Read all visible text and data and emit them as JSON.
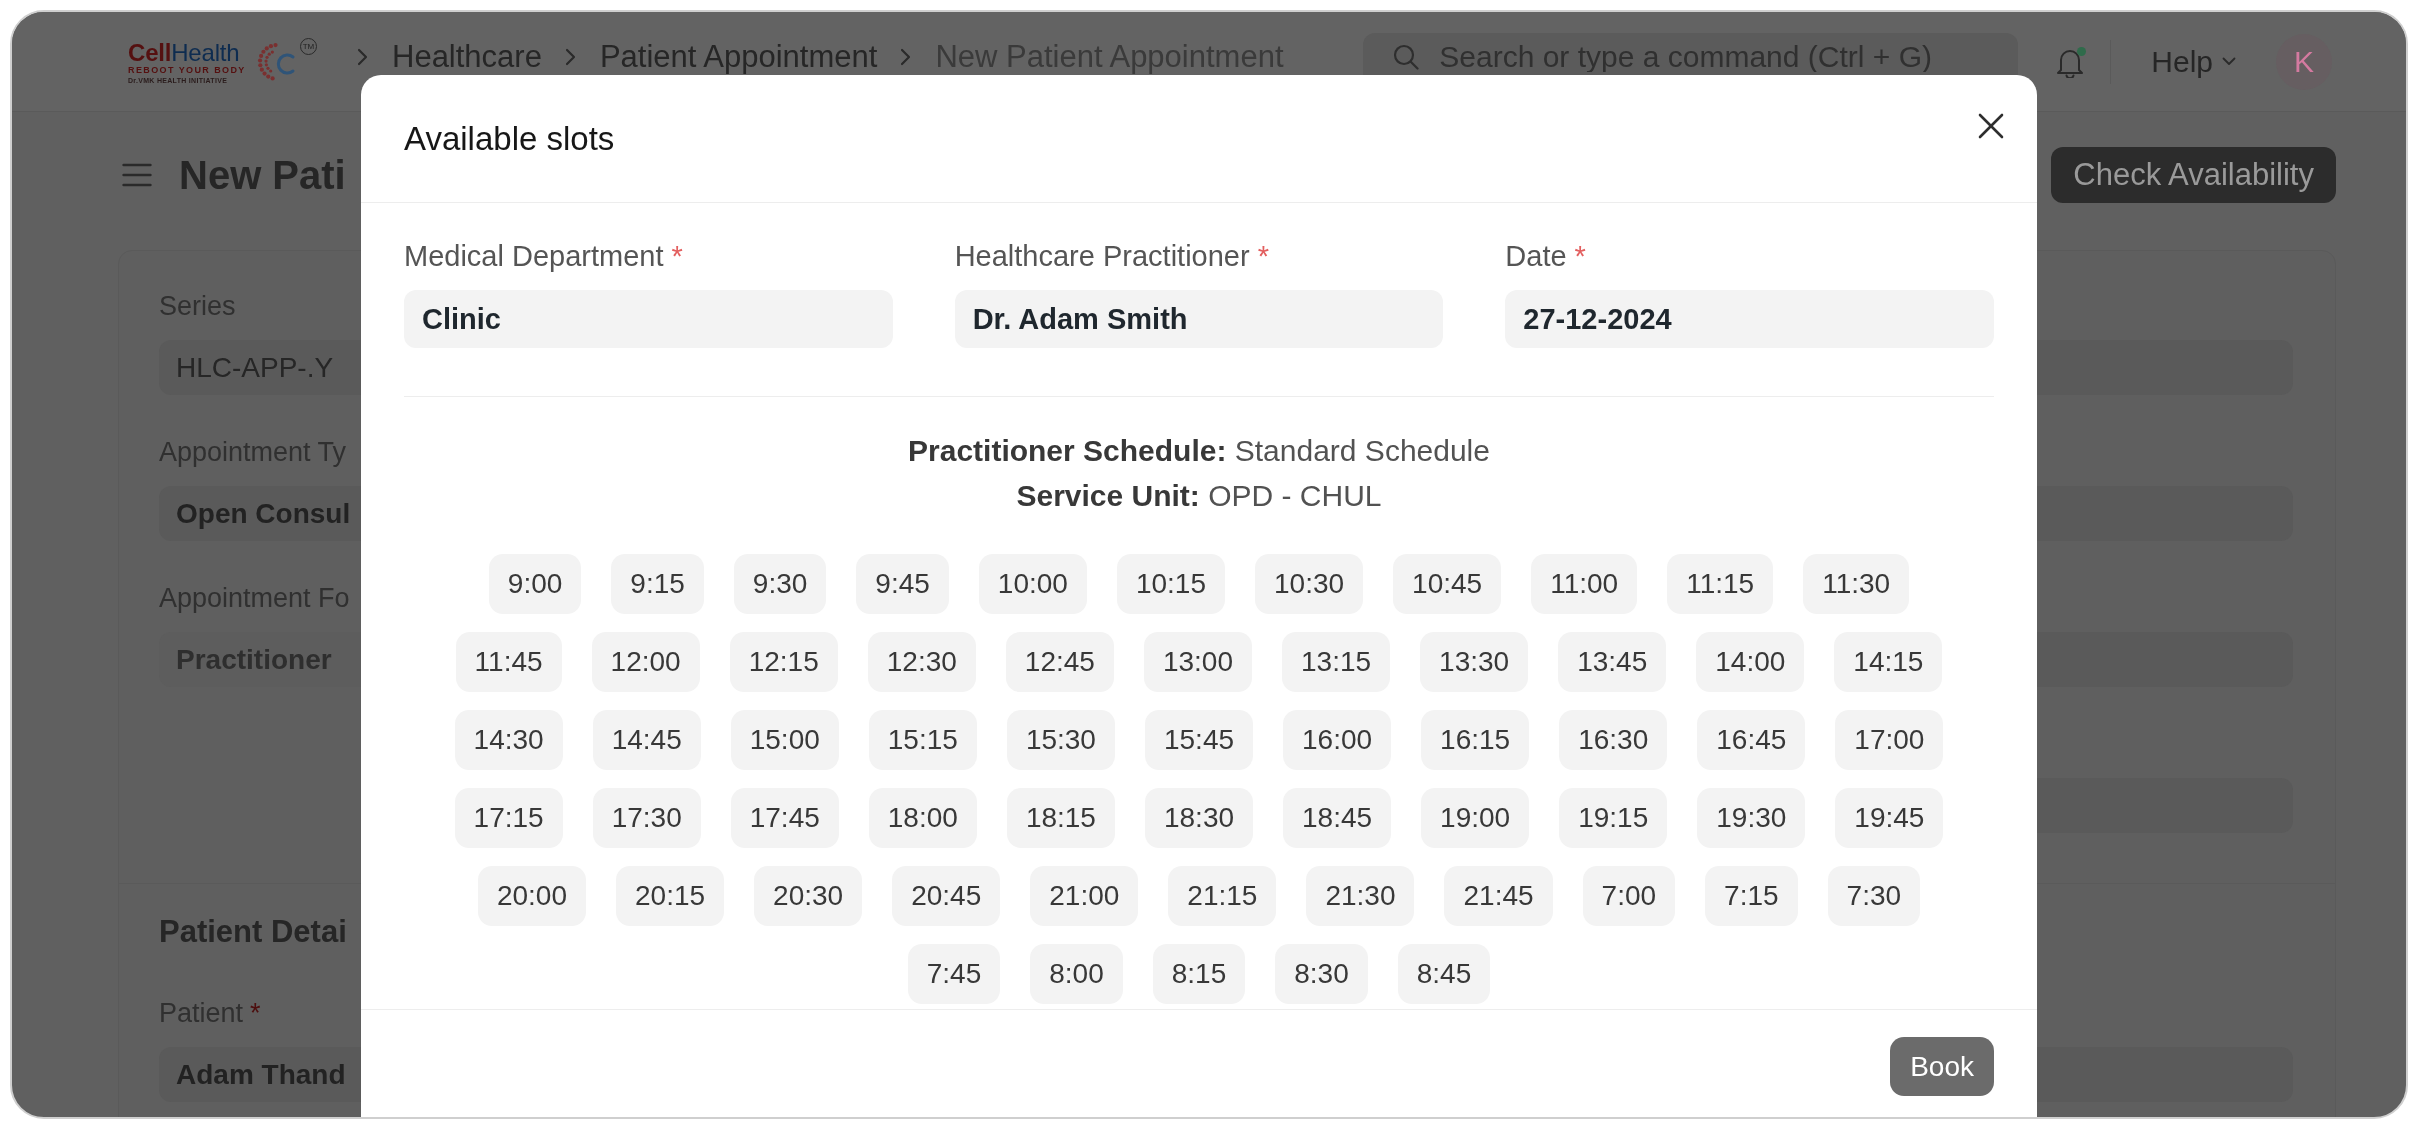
{
  "logo": {
    "brand_first": "Cell",
    "brand_second": "Health",
    "tagline": "REBOOT YOUR BODY",
    "subline": "Dr.VMK HEALTH INITIATIVE",
    "trademark": "TM"
  },
  "breadcrumbs": [
    {
      "label": "Healthcare",
      "current": false
    },
    {
      "label": "Patient Appointment",
      "current": false
    },
    {
      "label": "New Patient Appointment",
      "current": true
    }
  ],
  "search": {
    "placeholder": "Search or type a command (Ctrl + G)"
  },
  "notifications": {
    "unread": true
  },
  "help_menu": {
    "label": "Help"
  },
  "avatar": {
    "initial": "K"
  },
  "page_title": "New Pati",
  "primary_action": {
    "label": "Check Availability"
  },
  "form": {
    "details": {
      "fields": [
        {
          "label": "Series",
          "kind": "select",
          "value": "HLC-APP-.Y"
        },
        {
          "label": "Appointment Ty",
          "kind": "link",
          "value": "Open Consul"
        },
        {
          "label": "Appointment Fo",
          "kind": "read_only",
          "value": "Practitioner"
        }
      ],
      "side_fields": [
        {
          "kind": "input"
        },
        {
          "kind": "input"
        },
        {
          "kind": "input"
        },
        {
          "kind": "input"
        }
      ]
    },
    "patient_section": {
      "heading": "Patient Detai",
      "fields": [
        {
          "label": "Patient",
          "required_mark": "*",
          "kind": "link",
          "value": "Adam Thand"
        }
      ],
      "side_fields": [
        {
          "kind": "input"
        }
      ]
    }
  },
  "dialog": {
    "title": "Available slots",
    "fields": [
      {
        "label": "Medical Department",
        "required_mark": "*",
        "value": "Clinic"
      },
      {
        "label": "Healthcare Practitioner",
        "required_mark": "*",
        "value": "Dr. Adam Smith"
      },
      {
        "label": "Date",
        "required_mark": "*",
        "value": "27-12-2024"
      }
    ],
    "schedule": [
      "**Practitioner Schedule:** Standard Schedule",
      "**Service Unit:** OPD - CHUL"
    ],
    "slots": [
      {
        "time": "9:00",
        "selected": false
      },
      {
        "time": "9:15",
        "selected": false
      },
      {
        "time": "9:30",
        "selected": false
      },
      {
        "time": "9:45",
        "selected": false
      },
      {
        "time": "10:00",
        "selected": false
      },
      {
        "time": "10:15",
        "selected": false
      },
      {
        "time": "10:30",
        "selected": false
      },
      {
        "time": "10:45",
        "selected": false
      },
      {
        "time": "11:00",
        "selected": false
      },
      {
        "time": "11:15",
        "selected": false
      },
      {
        "time": "11:30",
        "selected": false
      },
      {
        "time": "11:45",
        "selected": false
      },
      {
        "time": "12:00",
        "selected": false
      },
      {
        "time": "12:15",
        "selected": false
      },
      {
        "time": "12:30",
        "selected": false
      },
      {
        "time": "12:45",
        "selected": false
      },
      {
        "time": "13:00",
        "selected": false
      },
      {
        "time": "13:15",
        "selected": false
      },
      {
        "time": "13:30",
        "selected": false
      },
      {
        "time": "13:45",
        "selected": false
      },
      {
        "time": "14:00",
        "selected": false
      },
      {
        "time": "14:15",
        "selected": false
      },
      {
        "time": "14:30",
        "selected": false
      },
      {
        "time": "14:45",
        "selected": false
      },
      {
        "time": "15:00",
        "selected": false
      },
      {
        "time": "15:15",
        "selected": false
      },
      {
        "time": "15:30",
        "selected": false
      },
      {
        "time": "15:45",
        "selected": false
      },
      {
        "time": "16:00",
        "selected": false
      },
      {
        "time": "16:15",
        "selected": false
      },
      {
        "time": "16:30",
        "selected": false
      },
      {
        "time": "16:45",
        "selected": false
      },
      {
        "time": "17:00",
        "selected": false
      },
      {
        "time": "17:15",
        "selected": false
      },
      {
        "time": "17:30",
        "selected": false
      },
      {
        "time": "17:45",
        "selected": false
      },
      {
        "time": "18:00",
        "selected": false
      },
      {
        "time": "18:15",
        "selected": false
      },
      {
        "time": "18:30",
        "selected": false
      },
      {
        "time": "18:45",
        "selected": false
      },
      {
        "time": "19:00",
        "selected": false
      },
      {
        "time": "19:15",
        "selected": false
      },
      {
        "time": "19:30",
        "selected": false
      },
      {
        "time": "19:45",
        "selected": false
      },
      {
        "time": "20:00",
        "selected": false
      },
      {
        "time": "20:15",
        "selected": false
      },
      {
        "time": "20:30",
        "selected": false
      },
      {
        "time": "20:45",
        "selected": false
      },
      {
        "time": "21:00",
        "selected": false
      },
      {
        "time": "21:15",
        "selected": false
      },
      {
        "time": "21:30",
        "selected": false
      },
      {
        "time": "21:45",
        "selected": false
      },
      {
        "time": "7:00",
        "selected": false
      },
      {
        "time": "7:15",
        "selected": false
      },
      {
        "time": "7:30",
        "selected": false
      },
      {
        "time": "7:45",
        "selected": false
      },
      {
        "time": "8:00",
        "selected": false
      },
      {
        "time": "8:15",
        "selected": false
      },
      {
        "time": "8:30",
        "selected": false
      },
      {
        "time": "8:45",
        "selected": false
      }
    ],
    "book_button": {
      "label": "Book",
      "disabled": true
    }
  }
}
